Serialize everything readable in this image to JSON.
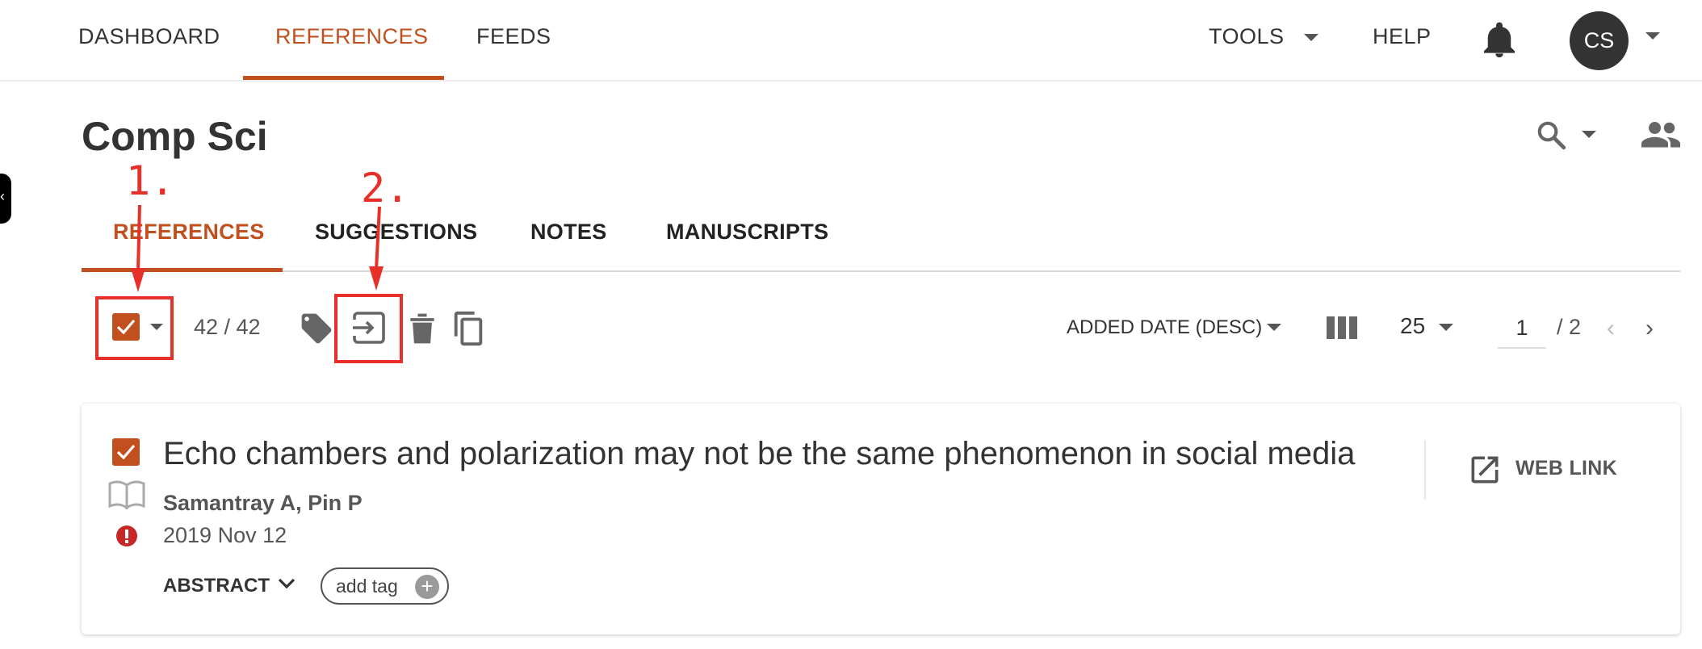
{
  "nav": {
    "dashboard": "DASHBOARD",
    "references": "REFERENCES",
    "feeds": "FEEDS",
    "tools": "TOOLS",
    "help": "HELP",
    "avatar_initials": "CS",
    "accent_color": "#c2501f"
  },
  "page": {
    "title": "Comp Sci"
  },
  "tabs": [
    {
      "label": "REFERENCES",
      "active": true
    },
    {
      "label": "SUGGESTIONS",
      "active": false
    },
    {
      "label": "NOTES",
      "active": false
    },
    {
      "label": "MANUSCRIPTS",
      "active": false
    }
  ],
  "toolbar": {
    "selected_count": "42 / 42",
    "sort_label": "ADDED DATE (DESC)",
    "per_page": "25",
    "page_current": "1",
    "page_total": "/ 2"
  },
  "annotations": {
    "step1": "1.",
    "step2": "2.",
    "color": "#e8302a"
  },
  "reference": {
    "title": "Echo chambers and polarization may not be the same phenomenon in social media",
    "authors": "Samantray A, Pin P",
    "date": "2019 Nov 12",
    "abstract_label": "ABSTRACT",
    "add_tag": "add tag",
    "web_link": "WEB LINK"
  }
}
